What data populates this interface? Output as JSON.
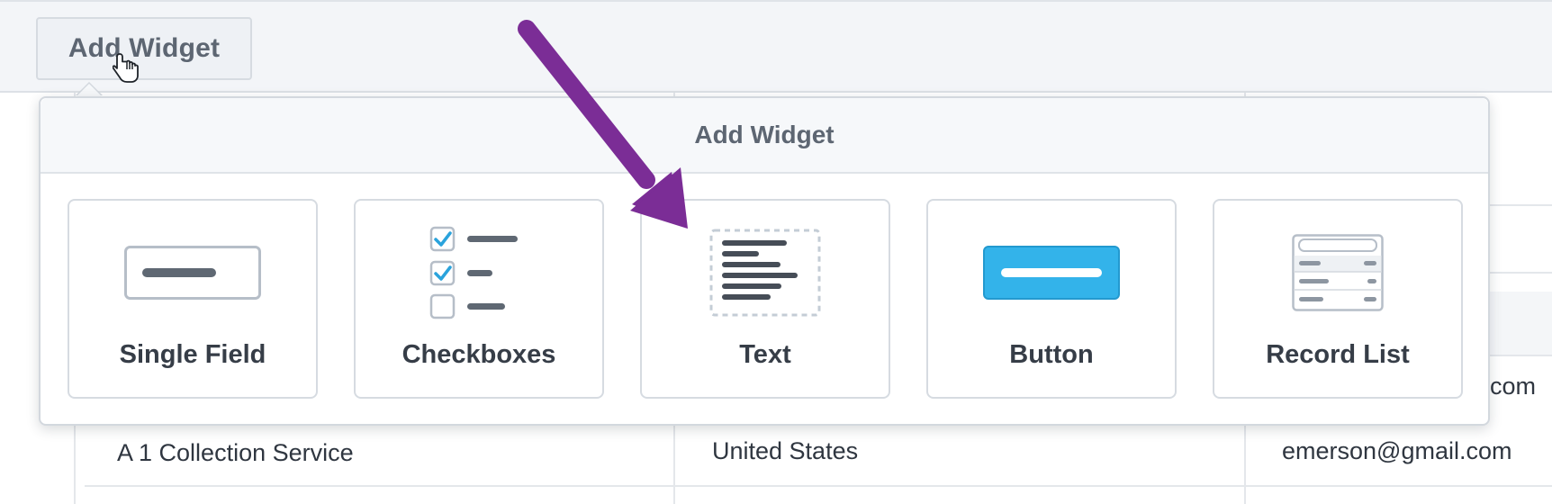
{
  "toolbar": {
    "add_widget_label": "Add Widget"
  },
  "popover": {
    "title": "Add Widget",
    "widgets": [
      {
        "label": "Single Field",
        "icon": "single-field-icon"
      },
      {
        "label": "Checkboxes",
        "icon": "checkboxes-icon"
      },
      {
        "label": "Text",
        "icon": "text-icon"
      },
      {
        "label": "Button",
        "icon": "button-icon"
      },
      {
        "label": "Record List",
        "icon": "record-list-icon"
      }
    ]
  },
  "table": {
    "rows": [
      {
        "name": "",
        "country": "",
        "email": "com"
      },
      {
        "name": "A 1 Collection Service",
        "country": "United States",
        "email": "emerson@gmail.com"
      }
    ]
  },
  "colors": {
    "annotation_arrow": "#7b2d96",
    "button_widget": "#33b3ea",
    "checkbox_check": "#2aa3dc",
    "text_line": "#464d57"
  }
}
